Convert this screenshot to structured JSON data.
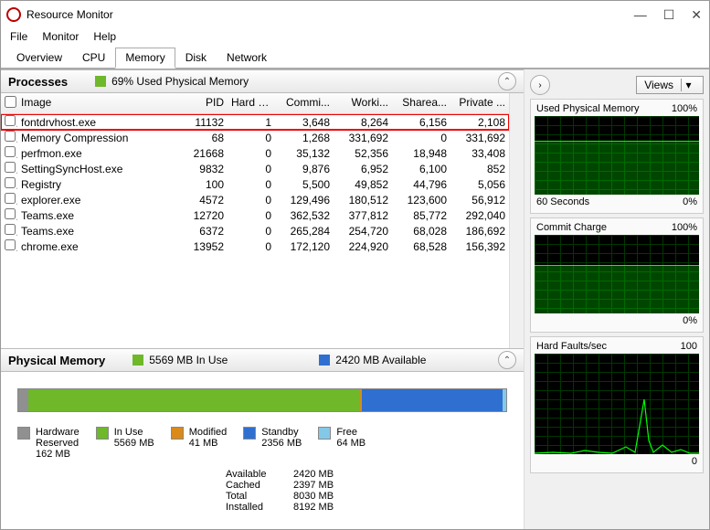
{
  "window": {
    "title": "Resource Monitor",
    "minimize": "—",
    "maximize": "☐",
    "close": "✕"
  },
  "menu": [
    "File",
    "Monitor",
    "Help"
  ],
  "tabs": [
    {
      "label": "Overview"
    },
    {
      "label": "CPU"
    },
    {
      "label": "Memory"
    },
    {
      "label": "Disk"
    },
    {
      "label": "Network"
    }
  ],
  "active_tab": 2,
  "processes": {
    "title": "Processes",
    "indicator_pct": "69% Used Physical Memory",
    "indicator_color": "#6eb82a",
    "columns": [
      "Image",
      "PID",
      "Hard F...",
      "Commi...",
      "Worki...",
      "Sharea...",
      "Private ..."
    ],
    "rows": [
      {
        "image": "fontdrvhost.exe",
        "pid": "11132",
        "hard": "1",
        "commit": "3,648",
        "working": "8,264",
        "share": "6,156",
        "private": "2,108",
        "highlight": true
      },
      {
        "image": "Memory Compression",
        "pid": "68",
        "hard": "0",
        "commit": "1,268",
        "working": "331,692",
        "share": "0",
        "private": "331,692"
      },
      {
        "image": "perfmon.exe",
        "pid": "21668",
        "hard": "0",
        "commit": "35,132",
        "working": "52,356",
        "share": "18,948",
        "private": "33,408"
      },
      {
        "image": "SettingSyncHost.exe",
        "pid": "9832",
        "hard": "0",
        "commit": "9,876",
        "working": "6,952",
        "share": "6,100",
        "private": "852"
      },
      {
        "image": "Registry",
        "pid": "100",
        "hard": "0",
        "commit": "5,500",
        "working": "49,852",
        "share": "44,796",
        "private": "5,056"
      },
      {
        "image": "explorer.exe",
        "pid": "4572",
        "hard": "0",
        "commit": "129,496",
        "working": "180,512",
        "share": "123,600",
        "private": "56,912"
      },
      {
        "image": "Teams.exe",
        "pid": "12720",
        "hard": "0",
        "commit": "362,532",
        "working": "377,812",
        "share": "85,772",
        "private": "292,040"
      },
      {
        "image": "Teams.exe",
        "pid": "6372",
        "hard": "0",
        "commit": "265,284",
        "working": "254,720",
        "share": "68,028",
        "private": "186,692"
      },
      {
        "image": "chrome.exe",
        "pid": "13952",
        "hard": "0",
        "commit": "172,120",
        "working": "224,920",
        "share": "68,528",
        "private": "156,392"
      }
    ]
  },
  "physical_memory": {
    "title": "Physical Memory",
    "in_use_label": "5569 MB In Use",
    "in_use_color": "#6eb82a",
    "available_label": "2420 MB Available",
    "available_color": "#2f6fd0",
    "bar_segments": [
      {
        "color": "#909090",
        "pct": 2.0
      },
      {
        "color": "#6eb82a",
        "pct": 68.0
      },
      {
        "color": "#d98a1a",
        "pct": 0.5
      },
      {
        "color": "#2f6fd0",
        "pct": 28.7
      },
      {
        "color": "#84c8e8",
        "pct": 0.8
      }
    ],
    "legend": [
      {
        "color": "#909090",
        "label": "Hardware",
        "sub": "Reserved",
        "val": "162 MB"
      },
      {
        "color": "#6eb82a",
        "label": "In Use",
        "sub": "5569 MB",
        "val": ""
      },
      {
        "color": "#d98a1a",
        "label": "Modified",
        "sub": "41 MB",
        "val": ""
      },
      {
        "color": "#2f6fd0",
        "label": "Standby",
        "sub": "2356 MB",
        "val": ""
      },
      {
        "color": "#84c8e8",
        "label": "Free",
        "sub": "64 MB",
        "val": ""
      }
    ],
    "stats": [
      {
        "label": "Available",
        "val": "2420 MB"
      },
      {
        "label": "Cached",
        "val": "2397 MB"
      },
      {
        "label": "Total",
        "val": "8030 MB"
      },
      {
        "label": "Installed",
        "val": "8192 MB"
      }
    ]
  },
  "graphs": {
    "views_label": "Views",
    "used_phys": {
      "title": "Used Physical Memory",
      "max": "100%",
      "fill_pct": 69,
      "bottom_left": "60 Seconds",
      "bottom_right": "0%"
    },
    "commit": {
      "title": "Commit Charge",
      "max": "100%",
      "fill_pct": 62,
      "bottom_left": "",
      "bottom_right": "0%"
    },
    "hard_faults": {
      "title": "Hard Faults/sec",
      "max": "100",
      "bottom_left": "",
      "bottom_right": "0"
    }
  }
}
